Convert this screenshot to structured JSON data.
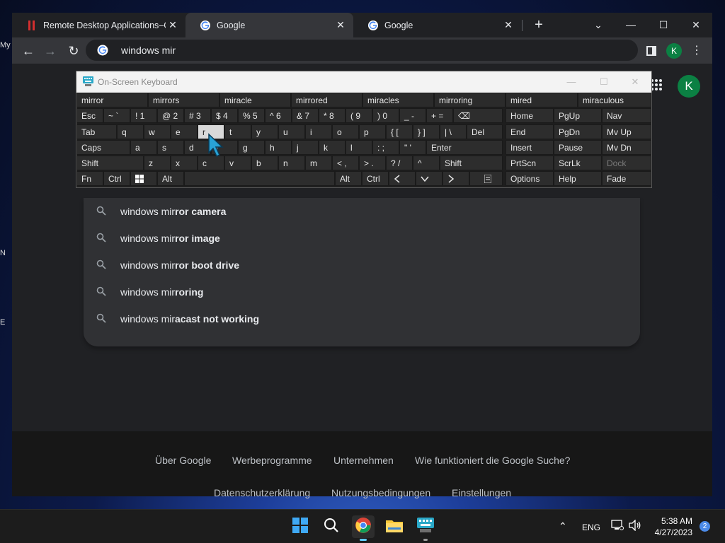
{
  "desktop": {
    "icon_label_partial": "My",
    "icon_label_n": "N",
    "icon_label_e": "E"
  },
  "browser": {
    "tabs": [
      {
        "title": "Remote Desktop Applications–G",
        "active": false,
        "favicon": "remote-desktop-icon"
      },
      {
        "title": "Google",
        "active": true,
        "favicon": "google-icon"
      },
      {
        "title": "Google",
        "active": false,
        "favicon": "google-icon"
      }
    ],
    "new_tab": "+",
    "omnibox_value": "windows mir",
    "profile_initial": "K"
  },
  "page": {
    "avatar_initial": "K",
    "suggestions": [
      {
        "prefix": "windows mir",
        "bold": "ror camera"
      },
      {
        "prefix": "windows mir",
        "bold": "ror image"
      },
      {
        "prefix": "windows mir",
        "bold": "ror boot drive"
      },
      {
        "prefix": "windows mir",
        "bold": "roring"
      },
      {
        "prefix": "windows mir",
        "bold": "acast not working"
      }
    ],
    "footer_row1": [
      "Über Google",
      "Werbeprogramme",
      "Unternehmen",
      "Wie funktioniert die Google Suche?"
    ],
    "footer_row2": [
      "Datenschutzerklärung",
      "Nutzungsbedingungen",
      "Einstellungen"
    ]
  },
  "osk": {
    "title": "On-Screen Keyboard",
    "predictions": [
      "mirror",
      "mirrors",
      "miracle",
      "mirrored",
      "miracles",
      "mirroring",
      "mired",
      "miraculous"
    ],
    "row1": [
      "Esc",
      "~ `",
      "! 1",
      "@ 2",
      "# 3",
      "$ 4",
      "% 5",
      "^ 6",
      "& 7",
      "* 8",
      "( 9",
      ") 0",
      "_ -",
      "+ =",
      "⌫"
    ],
    "row2": [
      "Tab",
      "q",
      "w",
      "e",
      "r",
      "t",
      "y",
      "u",
      "i",
      "o",
      "p",
      "{ [",
      "} ]",
      "| \\",
      "Del"
    ],
    "row3": [
      "Caps",
      "a",
      "s",
      "d",
      "f",
      "g",
      "h",
      "j",
      "k",
      "l",
      ": ;",
      "\" '",
      "Enter"
    ],
    "row4": [
      "Shift",
      "z",
      "x",
      "c",
      "v",
      "b",
      "n",
      "m",
      "< ,",
      "> .",
      "? /",
      "^",
      "Shift"
    ],
    "row5": [
      "Fn",
      "Ctrl",
      "Win",
      "Alt",
      "",
      "Alt",
      "Ctrl",
      "<",
      "v",
      ">",
      "Menu"
    ],
    "nav": [
      [
        "Home",
        "PgUp",
        "Nav"
      ],
      [
        "End",
        "PgDn",
        "Mv Up"
      ],
      [
        "Insert",
        "Pause",
        "Mv Dn"
      ],
      [
        "PrtScn",
        "ScrLk",
        "Dock"
      ],
      [
        "Options",
        "Help",
        "Fade"
      ]
    ],
    "highlighted_key": "r"
  },
  "taskbar": {
    "language": "ENG",
    "time": "5:38 AM",
    "date": "4/27/2023",
    "notification_count": "2"
  },
  "colors": {
    "chrome_dark": "#202124",
    "chrome_toolbar": "#35363a",
    "suggest_bg": "#303134",
    "profile_green": "#0b8043",
    "osk_key": "#2d2d2d"
  }
}
